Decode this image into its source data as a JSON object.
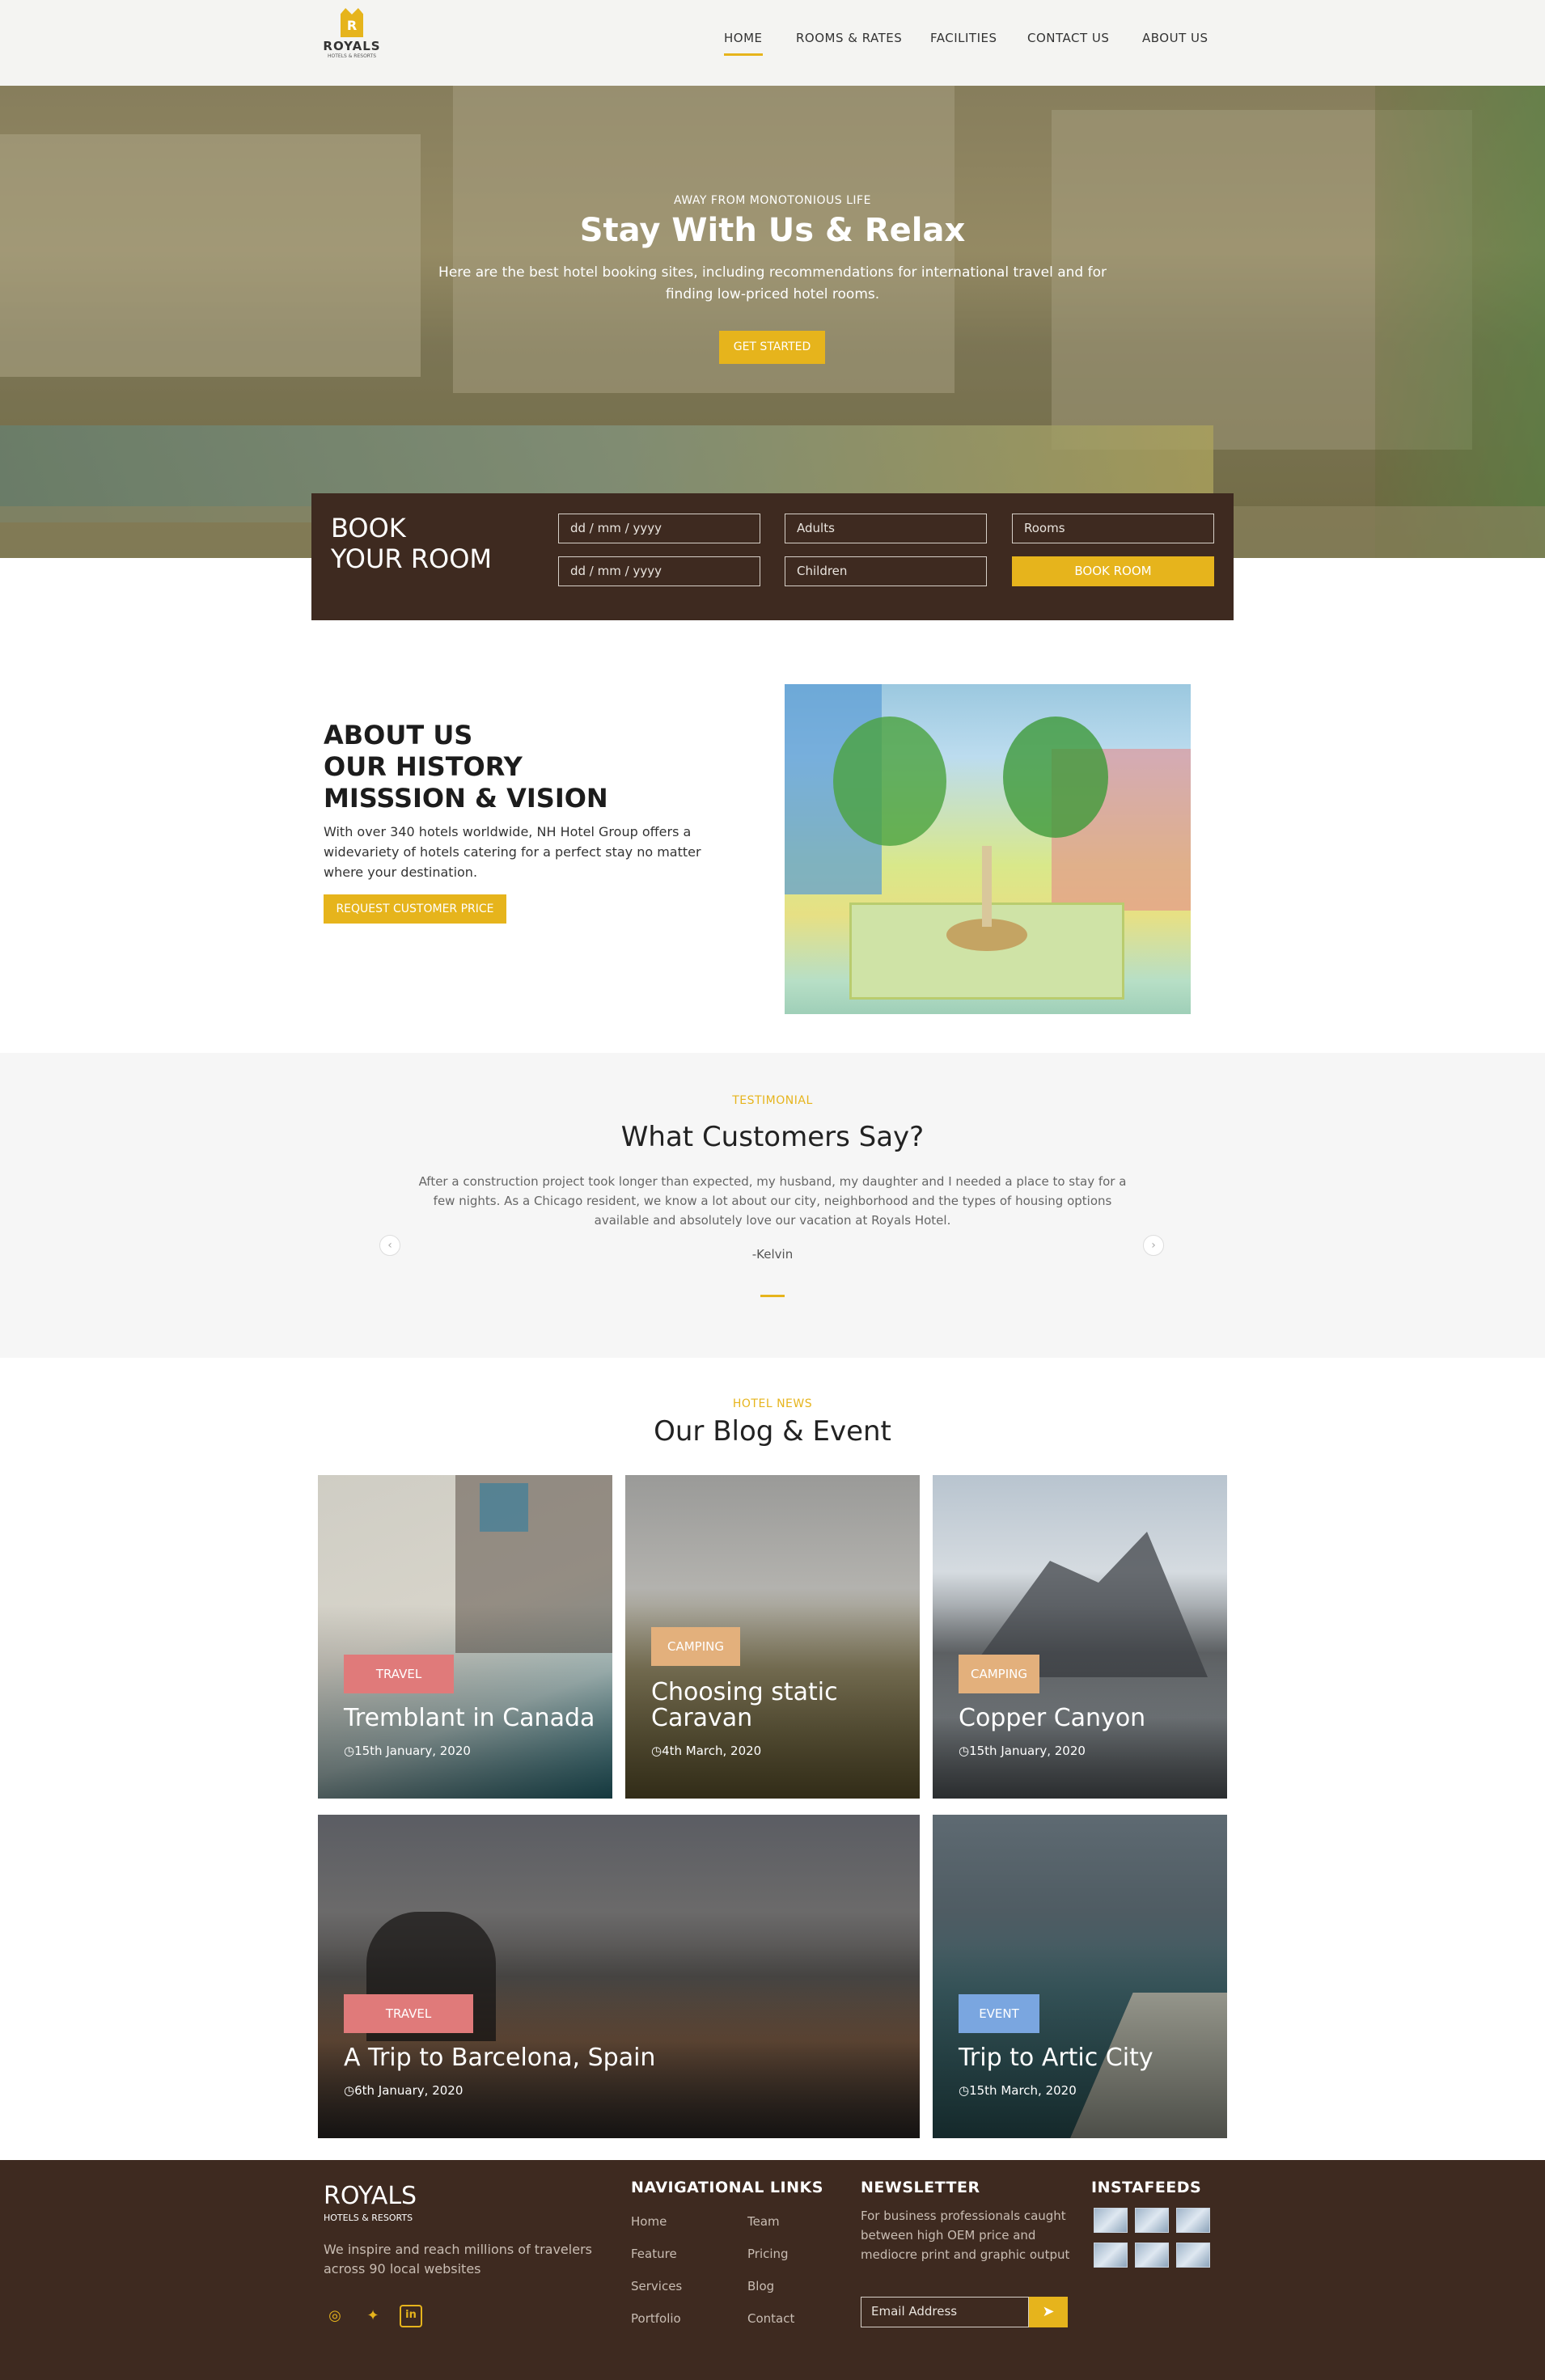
{
  "header": {
    "logo_name": "ROYALS",
    "logo_sub": "HOTELS & RESORTS",
    "logo_letter": "R",
    "nav": [
      "HOME",
      "ROOMS & RATES",
      "FACILITIES",
      "CONTACT US",
      "ABOUT US"
    ]
  },
  "hero": {
    "kicker": "AWAY FROM MONOTONIOUS LIFE",
    "title": "Stay With Us & Relax",
    "desc": "Here are the best hotel booking sites, including recommendations for international travel and for finding low-priced hotel rooms.",
    "button": "GET STARTED"
  },
  "booking": {
    "title_line1": "BOOK",
    "title_line2": "YOUR ROOM",
    "date1": "dd / mm / yyyy",
    "date2": "dd / mm / yyyy",
    "adults": "Adults",
    "children": "Children",
    "rooms": "Rooms",
    "button": "BOOK ROOM"
  },
  "about": {
    "line1": "ABOUT US",
    "line2": "OUR HISTORY",
    "line3": "MISSSION & VISION",
    "desc": "With over 340 hotels worldwide, NH Hotel Group offers a widevariety of hotels catering for a perfect stay no matter where your destination.",
    "button": "REQUEST CUSTOMER PRICE"
  },
  "testimonial": {
    "kicker": "TESTIMONIAL",
    "title": "What Customers Say?",
    "quote": "After a construction project took longer than expected, my husband, my daughter and I needed a place to stay for a few nights. As a Chicago resident, we know a lot about our city, neighborhood and the types of housing options available and absolutely love our vacation at Royals Hotel.",
    "author": "-Kelvin",
    "prev": "‹",
    "next": "›"
  },
  "blog": {
    "kicker": "HOTEL NEWS",
    "title": "Our Blog & Event",
    "cards": [
      {
        "tag": "TRAVEL",
        "title": "Tremblant in Canada",
        "date": "15th January, 2020",
        "tag_color": "#e07a7a"
      },
      {
        "tag": "CAMPING",
        "title": "Choosing static Caravan",
        "date": "4th March, 2020",
        "tag_color": "#e3b07c"
      },
      {
        "tag": "CAMPING",
        "title": "Copper Canyon",
        "date": "15th January, 2020",
        "tag_color": "#e3b07c"
      },
      {
        "tag": "TRAVEL",
        "title": "A Trip to Barcelona, Spain",
        "date": "6th January, 2020",
        "tag_color": "#e07a7a"
      },
      {
        "tag": "EVENT",
        "title": "Trip to Artic City",
        "date": "15th March, 2020",
        "tag_color": "#7aa6e0"
      }
    ]
  },
  "footer": {
    "brand": "ROYALS",
    "brand_sub": "HOTELS & RESORTS",
    "tagline": "We inspire and reach millions of travelers across 90 local websites",
    "nav_title": "NAVIGATIONAL LINKS",
    "links_col1": [
      "Home",
      "Feature",
      "Services",
      "Portfolio"
    ],
    "links_col2": [
      "Team",
      "Pricing",
      "Blog",
      "Contact"
    ],
    "news_title": "NEWSLETTER",
    "news_desc": "For business professionals caught between high OEM price and mediocre print and graphic output",
    "email_placeholder": "Email Address",
    "send_icon": "paper-plane-icon",
    "insta_title": "INSTAFEEDS",
    "social": [
      "instagram-icon",
      "twitter-icon",
      "linkedin-icon"
    ]
  },
  "colors": {
    "accent": "#e6b41c",
    "dark_brown": "#3e2a20",
    "light_gray": "#f6f6f6"
  }
}
